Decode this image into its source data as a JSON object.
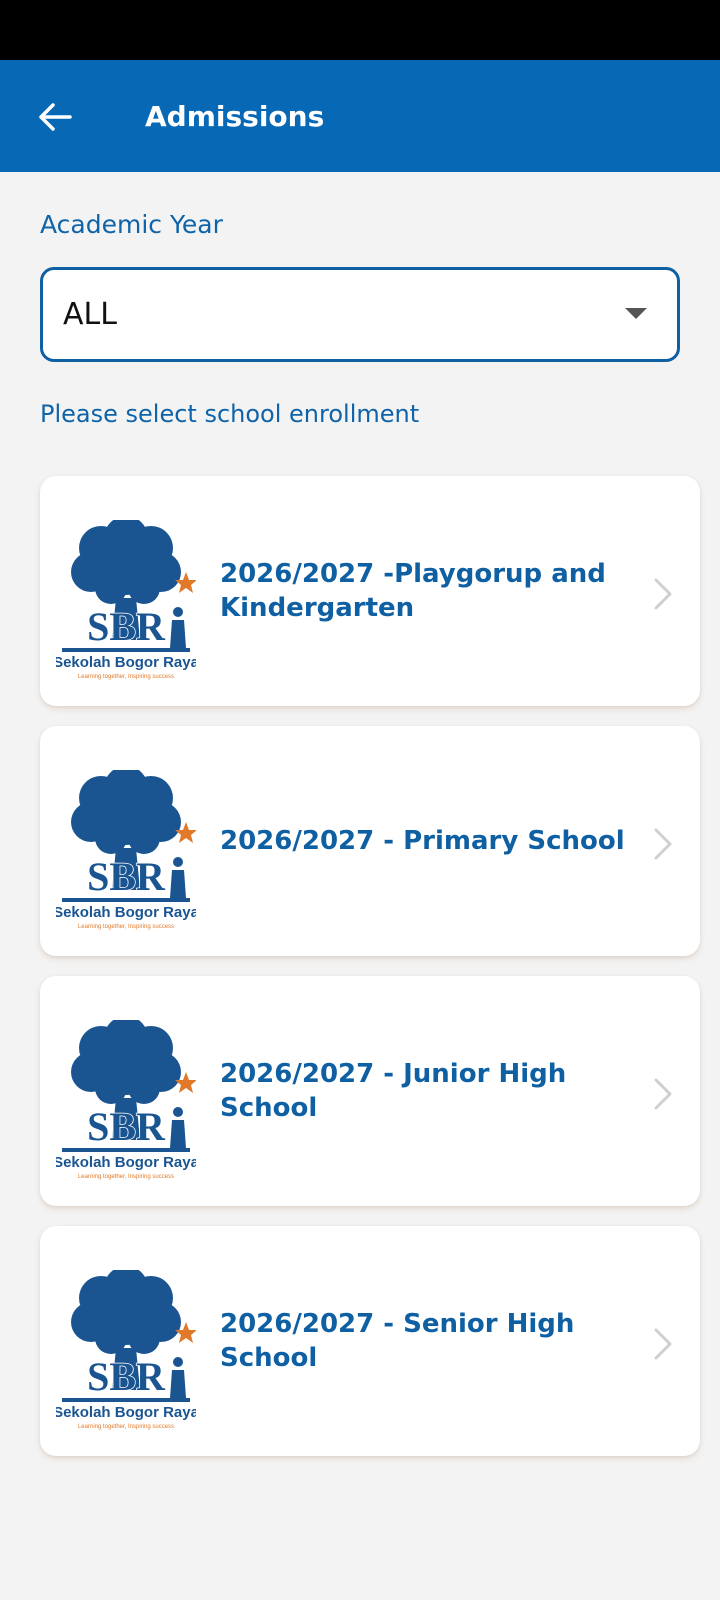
{
  "header": {
    "title": "Admissions"
  },
  "academic_year": {
    "label": "Academic Year",
    "selected": "ALL"
  },
  "helper_text": "Please select school enrollment",
  "logo": {
    "monogram": "SBR",
    "school_name": "Sekolah Bogor Raya",
    "tagline": "Learning together, Inspiring success"
  },
  "enrollments": [
    {
      "title": "2026/2027 -Playgorup and Kindergarten"
    },
    {
      "title": "2026/2027 - Primary School"
    },
    {
      "title": "2026/2027 - Junior High School"
    },
    {
      "title": "2026/2027 - Senior High School"
    }
  ],
  "colors": {
    "app_bar": "#0768b5",
    "accent": "#0f5fa3",
    "logo_blue": "#1a5592",
    "logo_star": "#e07a2a"
  }
}
